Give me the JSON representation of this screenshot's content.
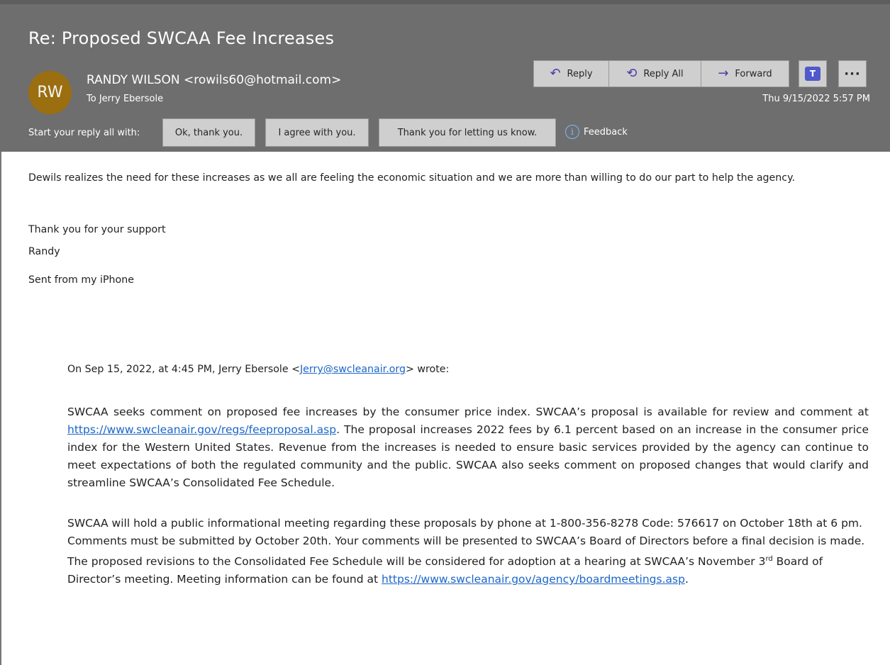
{
  "message": {
    "subject": "Re: Proposed SWCAA Fee Increases",
    "avatar_initials": "RW",
    "avatar_color": "#9b6e0f",
    "sender": "RANDY WILSON <rowils60@hotmail.com>",
    "to_prefix": "To",
    "to_name": "Jerry Ebersole",
    "date": "Thu 9/15/2022 5:57 PM"
  },
  "actions": {
    "reply": "Reply",
    "reply_all": "Reply All",
    "forward": "Forward",
    "more": "···"
  },
  "quick_replies": {
    "label": "Start your reply all with:",
    "options": [
      "Ok, thank you.",
      "I agree with you.",
      "Thank you for letting us know."
    ],
    "feedback": "Feedback"
  },
  "body": {
    "p1": "Dewils realizes the need for these increases as we all are feeling the economic situation and we are more than willing to do our part to help the agency.",
    "p2": "Thank you for your support",
    "p3": "Randy",
    "p4": "Sent from my iPhone",
    "quote_intro_before": "On Sep 15, 2022, at 4:45 PM, Jerry Ebersole <",
    "quote_intro_link": "Jerry@swcleanair.org",
    "quote_intro_after": "> wrote:",
    "q1_a": "SWCAA seeks comment on proposed fee increases by the consumer price index. SWCAA’s proposal is available for review and comment at ",
    "q1_link": "https://www.swcleanair.gov/regs/feeproposal.asp",
    "q1_b": ". The proposal increases 2022 fees by 6.1 percent based on an increase in the consumer price index for the Western United States. Revenue from the increases is needed to ensure basic services provided by the agency can continue to meet expectations of both the regulated community and the public. SWCAA also seeks comment on proposed changes that would clarify and streamline SWCAA’s Consolidated Fee Schedule.",
    "q2_a": "SWCAA will hold a public informational meeting regarding these proposals by phone at 1-800-356-8278 Code: 576617 on October 18th at 6 pm.  Comments must be submitted by October 20th. Your comments will be presented to SWCAA’s Board of Directors before a final decision is made. The proposed revisions to the Consolidated Fee Schedule will be considered for adoption at a hearing at SWCAA’s November 3",
    "q2_sup": "rd",
    "q2_b": " Board of Director’s meeting. Meeting information can be found at ",
    "q2_link": "https://www.swcleanair.gov/agency/boardmeetings.asp",
    "q2_c": "."
  }
}
